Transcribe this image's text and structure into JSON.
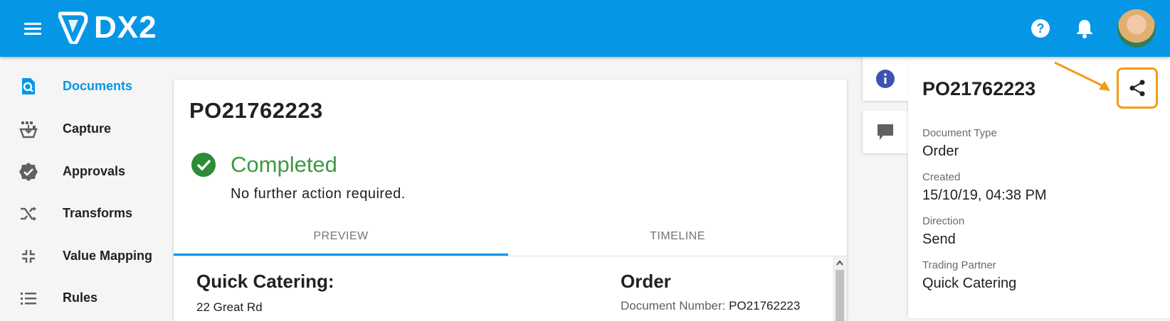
{
  "app": {
    "logo_text": "DX2",
    "brand_color": "#0597e6",
    "menu_icon": "hamburger-menu-icon",
    "help_icon": "help-icon",
    "notifications_icon": "bell-icon",
    "avatar": "user-avatar"
  },
  "sidebar": {
    "items": [
      {
        "label": "Documents",
        "icon": "document-search-icon",
        "active": true
      },
      {
        "label": "Capture",
        "icon": "capture-icon",
        "active": false
      },
      {
        "label": "Approvals",
        "icon": "verified-badge-icon",
        "active": false
      },
      {
        "label": "Transforms",
        "icon": "shuffle-icon",
        "active": false
      },
      {
        "label": "Value Mapping",
        "icon": "collapse-arrows-icon",
        "active": false
      },
      {
        "label": "Rules",
        "icon": "list-icon",
        "active": false
      }
    ]
  },
  "document": {
    "title": "PO21762223",
    "status": "Completed",
    "status_color": "#3c9a3f",
    "status_message": "No further action required.",
    "tabs": [
      {
        "label": "PREVIEW",
        "active": true
      },
      {
        "label": "TIMELINE",
        "active": false
      }
    ],
    "preview": {
      "company": "Quick Catering:",
      "address_line": "22 Great Rd",
      "doc_type_heading": "Order",
      "doc_number_label": "Document Number:",
      "doc_number_value": "PO21762223"
    }
  },
  "side_tabs": [
    {
      "icon": "info-icon",
      "active": true,
      "color": "#3f51b5"
    },
    {
      "icon": "comment-icon",
      "active": false,
      "color": "#616161"
    }
  ],
  "info_panel": {
    "title": "PO21762223",
    "share_icon": "share-icon",
    "highlight_color": "#f39c12",
    "fields": [
      {
        "label": "Document Type",
        "value": "Order"
      },
      {
        "label": "Created",
        "value": "15/10/19, 04:38 PM"
      },
      {
        "label": "Direction",
        "value": "Send"
      },
      {
        "label": "Trading Partner",
        "value": "Quick Catering"
      }
    ]
  }
}
